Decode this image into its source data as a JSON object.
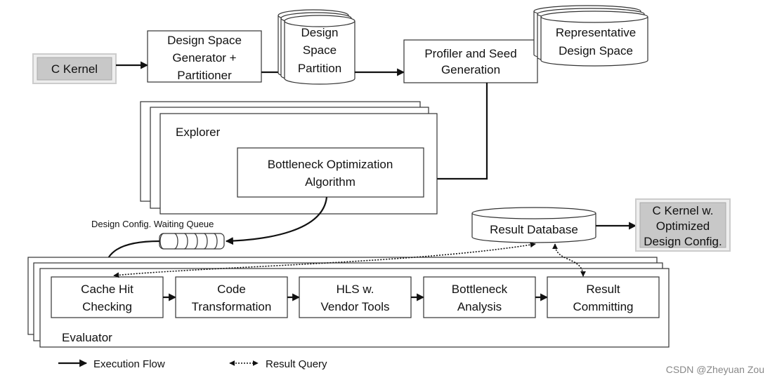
{
  "nodes": {
    "c_kernel": "C Kernel",
    "generator": [
      "Design Space",
      "Generator +",
      "Partitioner"
    ],
    "partition": [
      "Design",
      "Space",
      "Partition"
    ],
    "profiler": [
      "Profiler and Seed",
      "Generation"
    ],
    "representative": [
      "Representative",
      "Design Space"
    ],
    "explorer": "Explorer",
    "bottleneck_opt": [
      "Bottleneck Optimization",
      "Algorithm"
    ],
    "queue_label": "Design Config. Waiting Queue",
    "result_db": "Result Database",
    "optimized": [
      "C Kernel w.",
      "Optimized",
      "Design Config."
    ],
    "evaluator": "Evaluator",
    "stages": [
      [
        "Cache Hit",
        "Checking"
      ],
      [
        "Code",
        "Transformation"
      ],
      [
        "HLS w.",
        "Vendor Tools"
      ],
      [
        "Bottleneck",
        "Analysis"
      ],
      [
        "Result",
        "Committing"
      ]
    ]
  },
  "legend": {
    "execution": "Execution Flow",
    "query": "Result Query"
  },
  "watermark": "CSDN @Zheyuan Zou",
  "colors": {
    "highlight_fill": "#c8c8c8",
    "line": "#111111"
  }
}
